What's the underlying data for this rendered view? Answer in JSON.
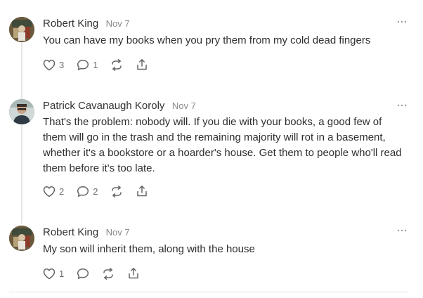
{
  "comments": [
    {
      "author": "Robert King",
      "date": "Nov 7",
      "text": "You can have my books when you pry them from my cold dead fingers",
      "likes": "3",
      "replies": "1"
    },
    {
      "author": "Patrick Cavanaugh Koroly",
      "date": "Nov 7",
      "text": "That's the problem: nobody will. If you die with your books, a good few of them will go in the trash and the remaining majority will rot in a basement, whether it's a bookstore or a hoarder's house. Get them to people who'll read them before it's too late.",
      "likes": "2",
      "replies": "2"
    },
    {
      "author": "Robert King",
      "date": "Nov 7",
      "text": "My son will inherit them, along with the house",
      "likes": "1",
      "replies": ""
    }
  ],
  "icons": {
    "like": "heart-icon",
    "reply": "comment-bubble-icon",
    "restack": "restack-arrows-icon",
    "share": "share-upload-icon",
    "more": "more-dots-icon"
  },
  "colors": {
    "text": "#2e2e2e",
    "muted": "#8a8a8a",
    "icon": "#6d6d6d",
    "thread_line": "#e6e6e6"
  }
}
